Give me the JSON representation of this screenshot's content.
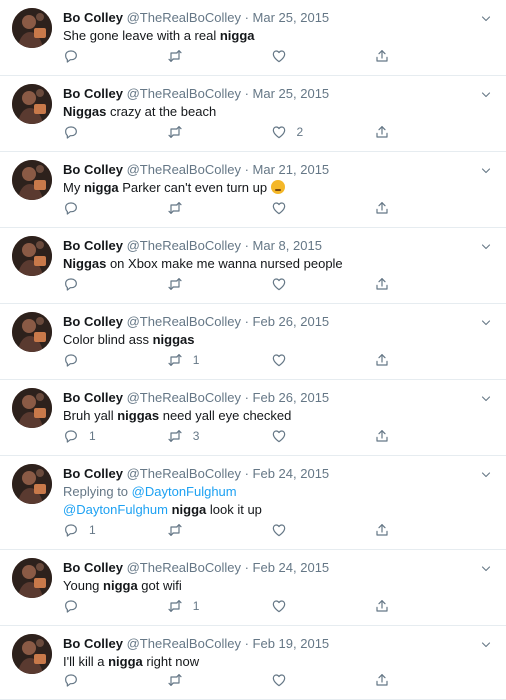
{
  "tweets": [
    {
      "name": "Bo Colley",
      "handle": "@TheRealBoColley",
      "dot": "·",
      "date": "Mar 25, 2015",
      "segments": [
        {
          "t": "She gone leave with a real "
        },
        {
          "t": "nigga",
          "b": true
        }
      ],
      "reply_count": "",
      "retweet_count": "",
      "like_count": ""
    },
    {
      "name": "Bo Colley",
      "handle": "@TheRealBoColley",
      "dot": "·",
      "date": "Mar 25, 2015",
      "segments": [
        {
          "t": "Niggas",
          "b": true
        },
        {
          "t": " crazy at the beach"
        }
      ],
      "reply_count": "",
      "retweet_count": "",
      "like_count": "2"
    },
    {
      "name": "Bo Colley",
      "handle": "@TheRealBoColley",
      "dot": "·",
      "date": "Mar 21, 2015",
      "segments": [
        {
          "t": "My "
        },
        {
          "t": "nigga",
          "b": true
        },
        {
          "t": " Parker can't even turn up "
        }
      ],
      "emoji": "relieved-face-emoji",
      "reply_count": "",
      "retweet_count": "",
      "like_count": ""
    },
    {
      "name": "Bo Colley",
      "handle": "@TheRealBoColley",
      "dot": "·",
      "date": "Mar 8, 2015",
      "segments": [
        {
          "t": "Niggas",
          "b": true
        },
        {
          "t": " on Xbox make me wanna nursed people"
        }
      ],
      "reply_count": "",
      "retweet_count": "",
      "like_count": ""
    },
    {
      "name": "Bo Colley",
      "handle": "@TheRealBoColley",
      "dot": "·",
      "date": "Feb 26, 2015",
      "segments": [
        {
          "t": "Color blind ass "
        },
        {
          "t": "niggas",
          "b": true
        }
      ],
      "reply_count": "",
      "retweet_count": "1",
      "like_count": ""
    },
    {
      "name": "Bo Colley",
      "handle": "@TheRealBoColley",
      "dot": "·",
      "date": "Feb 26, 2015",
      "segments": [
        {
          "t": "Bruh yall "
        },
        {
          "t": "niggas",
          "b": true
        },
        {
          "t": " need yall eye checked"
        }
      ],
      "reply_count": "1",
      "retweet_count": "3",
      "like_count": ""
    },
    {
      "name": "Bo Colley",
      "handle": "@TheRealBoColley",
      "dot": "·",
      "date": "Feb 24, 2015",
      "replying_prefix": "Replying to ",
      "replying_to": "@DaytonFulghum",
      "segments": [
        {
          "t": "@DaytonFulghum",
          "link": true
        },
        {
          "t": " "
        },
        {
          "t": "nigga",
          "b": true
        },
        {
          "t": " look it up"
        }
      ],
      "reply_count": "1",
      "retweet_count": "",
      "like_count": ""
    },
    {
      "name": "Bo Colley",
      "handle": "@TheRealBoColley",
      "dot": "·",
      "date": "Feb 24, 2015",
      "segments": [
        {
          "t": "Young "
        },
        {
          "t": "nigga",
          "b": true
        },
        {
          "t": " got wifi"
        }
      ],
      "reply_count": "",
      "retweet_count": "1",
      "like_count": ""
    },
    {
      "name": "Bo Colley",
      "handle": "@TheRealBoColley",
      "dot": "·",
      "date": "Feb 19, 2015",
      "segments": [
        {
          "t": "I'll kill a "
        },
        {
          "t": "nigga",
          "b": true
        },
        {
          "t": " right now"
        }
      ],
      "reply_count": "",
      "retweet_count": "",
      "like_count": ""
    }
  ],
  "icons": {
    "reply": "reply-icon",
    "retweet": "retweet-icon",
    "like": "like-icon",
    "share": "share-icon",
    "more": "chevron-down-icon"
  },
  "colors": {
    "text": "#14171a",
    "muted": "#657786",
    "link": "#1da1f2",
    "divider": "#e6ecf0"
  }
}
